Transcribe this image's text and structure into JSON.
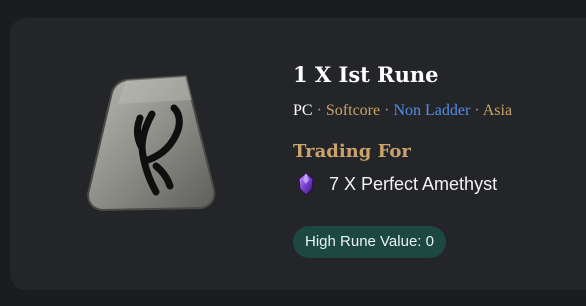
{
  "listing": {
    "title": "1 X Ist Rune",
    "platform": "PC",
    "separator": "·",
    "mode": "Softcore",
    "ladder": "Non Ladder",
    "region": "Asia",
    "trading_label": "Trading For",
    "offer_text": "7 X Perfect Amethyst",
    "badge_text": "High Rune Value: 0"
  },
  "colors": {
    "background": "#1b1c1e",
    "card": "#242528",
    "gold": "#c9a36a",
    "ladder_blue": "#4f8fe8",
    "badge_bg": "#1d4741"
  },
  "icons": {
    "rune": "ist-rune-icon",
    "gem": "perfect-amethyst-icon"
  }
}
